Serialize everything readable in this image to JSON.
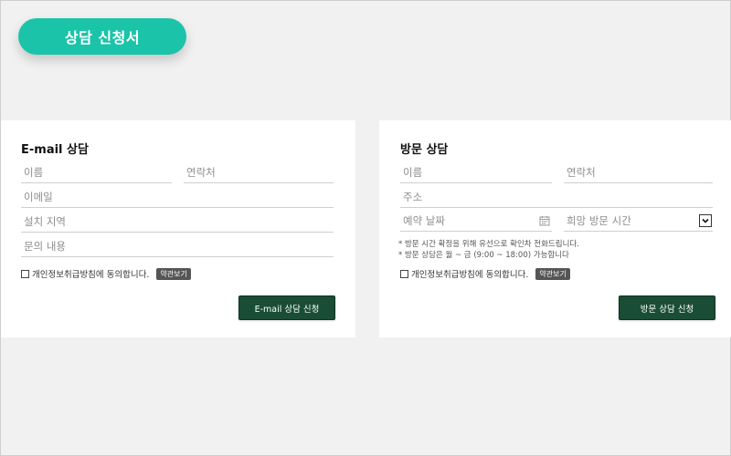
{
  "header": {
    "title": "상담 신청서"
  },
  "email_form": {
    "title": "E-mail 상담",
    "name_placeholder": "이름",
    "phone_placeholder": "연락처",
    "email_placeholder": "이메일",
    "region_placeholder": "설치 지역",
    "inquiry_placeholder": "문의 내용",
    "agree_label": "개인정보취급방침에 동의합니다.",
    "terms_label": "약관보기",
    "submit_label": "E-mail 상담 신청"
  },
  "visit_form": {
    "title": "방문 상담",
    "name_placeholder": "이름",
    "phone_placeholder": "연락처",
    "address_placeholder": "주소",
    "date_placeholder": "예약 날짜",
    "time_placeholder": "희망 방문 시간",
    "notes": [
      "* 방문 시간 확정을 위해 유선으로 확인차 전화드립니다.",
      "* 방문 상담은 월 ~ 금 (9:00 ~ 18:00) 가능합니다"
    ],
    "agree_label": "개인정보취급방침에 동의합니다.",
    "terms_label": "약관보기",
    "submit_label": "방문 상담 신청"
  },
  "colors": {
    "accent": "#1bc4a8",
    "button": "#1a4d35",
    "background": "#f1f1f1"
  },
  "icons": {
    "date": "calendar-icon",
    "select": "chevron-down-icon"
  }
}
